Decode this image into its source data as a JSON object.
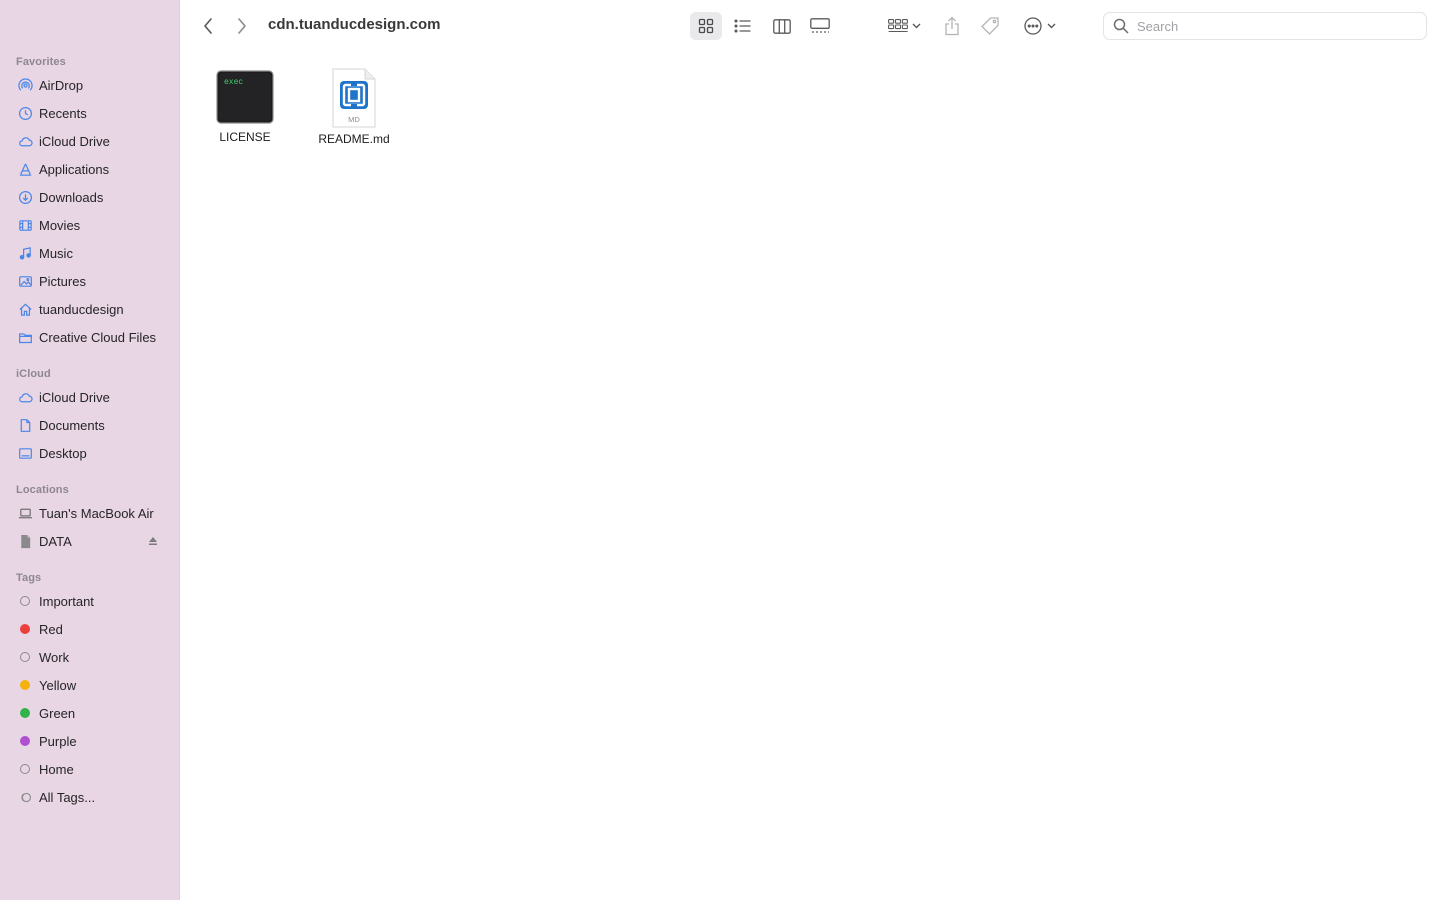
{
  "window": {
    "title": "cdn.tuanducdesign.com"
  },
  "search": {
    "placeholder": "Search",
    "value": ""
  },
  "sidebar": {
    "favorites_title": "Favorites",
    "favorites": [
      {
        "label": "AirDrop",
        "icon": "airdrop-icon"
      },
      {
        "label": "Recents",
        "icon": "clock-icon"
      },
      {
        "label": "iCloud Drive",
        "icon": "cloud-icon"
      },
      {
        "label": "Applications",
        "icon": "applications-icon"
      },
      {
        "label": "Downloads",
        "icon": "download-icon"
      },
      {
        "label": "Movies",
        "icon": "film-icon"
      },
      {
        "label": "Music",
        "icon": "music-note-icon"
      },
      {
        "label": "Pictures",
        "icon": "photo-icon"
      },
      {
        "label": "tuanducdesign",
        "icon": "home-icon"
      },
      {
        "label": "Creative Cloud Files",
        "icon": "folder-icon"
      }
    ],
    "icloud_title": "iCloud",
    "icloud": [
      {
        "label": "iCloud Drive",
        "icon": "cloud-icon"
      },
      {
        "label": "Documents",
        "icon": "document-icon"
      },
      {
        "label": "Desktop",
        "icon": "desktop-icon"
      }
    ],
    "locations_title": "Locations",
    "locations": [
      {
        "label": "Tuan's MacBook Air",
        "icon": "laptop-icon"
      },
      {
        "label": "DATA",
        "icon": "drive-icon"
      }
    ],
    "tags_title": "Tags",
    "tags": [
      {
        "label": "Important",
        "color": "none"
      },
      {
        "label": "Red",
        "color": "#ec3f3a"
      },
      {
        "label": "Work",
        "color": "none"
      },
      {
        "label": "Yellow",
        "color": "#f6b20c"
      },
      {
        "label": "Green",
        "color": "#30b34a"
      },
      {
        "label": "Purple",
        "color": "#b04fd1"
      },
      {
        "label": "Home",
        "color": "none"
      },
      {
        "label": "All Tags...",
        "color": "all"
      }
    ]
  },
  "files": [
    {
      "name": "LICENSE",
      "kind": "exec",
      "badge": "exec"
    },
    {
      "name": "README.md",
      "kind": "markdown",
      "badge": "MD"
    }
  ]
}
